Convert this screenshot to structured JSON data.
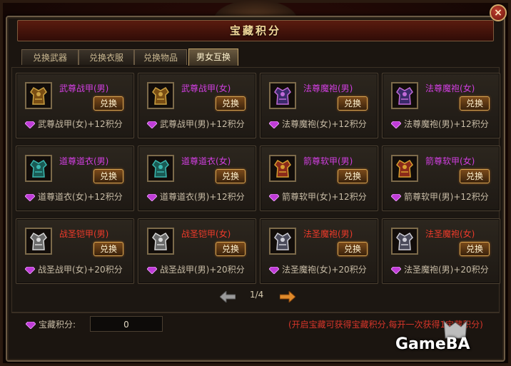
{
  "window": {
    "title": "宝藏积分",
    "close_label": "×"
  },
  "tabs": [
    {
      "label": "兑换武器",
      "active": false
    },
    {
      "label": "兑换衣服",
      "active": false
    },
    {
      "label": "兑换物品",
      "active": false
    },
    {
      "label": "男女互换",
      "active": true
    }
  ],
  "exchange_label": "兑换",
  "items": [
    {
      "name": "武尊战甲(男)",
      "color": "purple",
      "cost": "武尊战甲(女)+12积分",
      "icon": "armor-gold-icon"
    },
    {
      "name": "武尊战甲(女)",
      "color": "purple",
      "cost": "武尊战甲(男)+12积分",
      "icon": "armor-gold-icon"
    },
    {
      "name": "法尊魔袍(男)",
      "color": "purple",
      "cost": "法尊魔袍(女)+12积分",
      "icon": "robe-purple-icon"
    },
    {
      "name": "法尊魔袍(女)",
      "color": "purple",
      "cost": "法尊魔袍(男)+12积分",
      "icon": "robe-purple-icon"
    },
    {
      "name": "道尊道衣(男)",
      "color": "purple",
      "cost": "道尊道衣(女)+12积分",
      "icon": "robe-teal-icon"
    },
    {
      "name": "道尊道衣(女)",
      "color": "purple",
      "cost": "道尊道衣(男)+12积分",
      "icon": "robe-teal-icon"
    },
    {
      "name": "箭尊软甲(男)",
      "color": "purple",
      "cost": "箭尊软甲(女)+12积分",
      "icon": "armor-red-icon"
    },
    {
      "name": "箭尊软甲(女)",
      "color": "purple",
      "cost": "箭尊软甲(男)+12积分",
      "icon": "armor-red-icon"
    },
    {
      "name": "战圣铠甲(男)",
      "color": "red",
      "cost": "战圣战甲(女)+20积分",
      "icon": "armor-silver-icon"
    },
    {
      "name": "战圣铠甲(女)",
      "color": "red",
      "cost": "战圣战甲(男)+20积分",
      "icon": "armor-silver-icon"
    },
    {
      "name": "法圣魔袍(男)",
      "color": "red",
      "cost": "法圣魔袍(女)+20积分",
      "icon": "robe-silver-icon"
    },
    {
      "name": "法圣魔袍(女)",
      "color": "red",
      "cost": "法圣魔袍(男)+20积分",
      "icon": "robe-silver-icon"
    }
  ],
  "pager": {
    "text": "1/4"
  },
  "points": {
    "label": "宝藏积分:",
    "value": "0"
  },
  "note": "(开启宝藏可获得宝藏积分,每开一次获得1宝藏积分)",
  "watermark": "GameBA",
  "colors": {
    "purple_name": "#d13fe0",
    "red_name": "#ee3a2a",
    "note": "#d7352a",
    "gem": "#c03cd8"
  }
}
